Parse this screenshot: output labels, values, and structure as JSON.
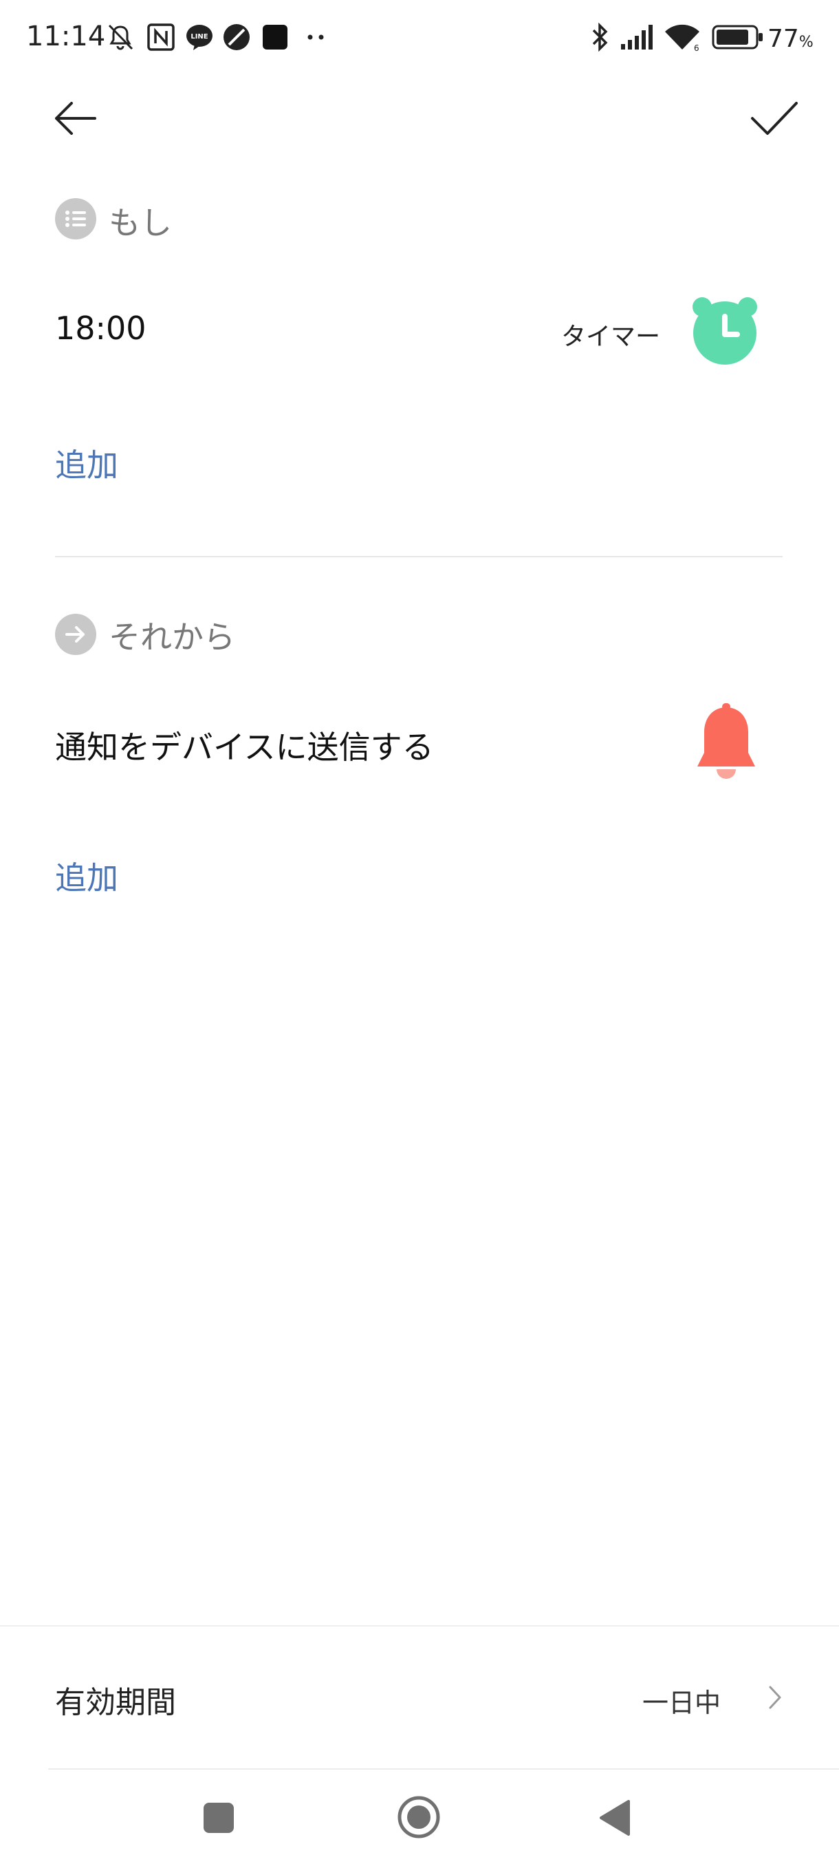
{
  "status_bar": {
    "time": "11:14",
    "battery_percent": "77",
    "battery_unit": "%",
    "battery_level": 0.77,
    "icons": [
      "mute-vibrate-icon",
      "nfc-icon",
      "line-icon",
      "app-icon",
      "app-square-icon",
      "more-dots-icon",
      "bluetooth-icon",
      "signal-icon",
      "wifi-icon",
      "battery-icon"
    ]
  },
  "header": {
    "back_icon": "arrow-left-icon",
    "confirm_icon": "checkmark-icon"
  },
  "if_section": {
    "label": "もし",
    "icon": "list-icon",
    "condition": {
      "value": "18:00",
      "type_label": "タイマー",
      "icon": "alarm-clock-icon",
      "icon_color": "#5ddbad"
    },
    "add_label": "追加"
  },
  "then_section": {
    "label": "それから",
    "icon": "arrow-right-icon",
    "action": {
      "label": "通知をデバイスに送信する",
      "icon": "bell-icon",
      "icon_color": "#fb6b5b"
    },
    "add_label": "追加"
  },
  "validity": {
    "label": "有効期間",
    "value": "一日中"
  },
  "nav": {
    "icons": [
      "recent-apps-icon",
      "home-icon",
      "back-icon"
    ]
  },
  "colors": {
    "accent_link": "#4c76b5",
    "section_icon_bg": "#c8c8c8"
  }
}
